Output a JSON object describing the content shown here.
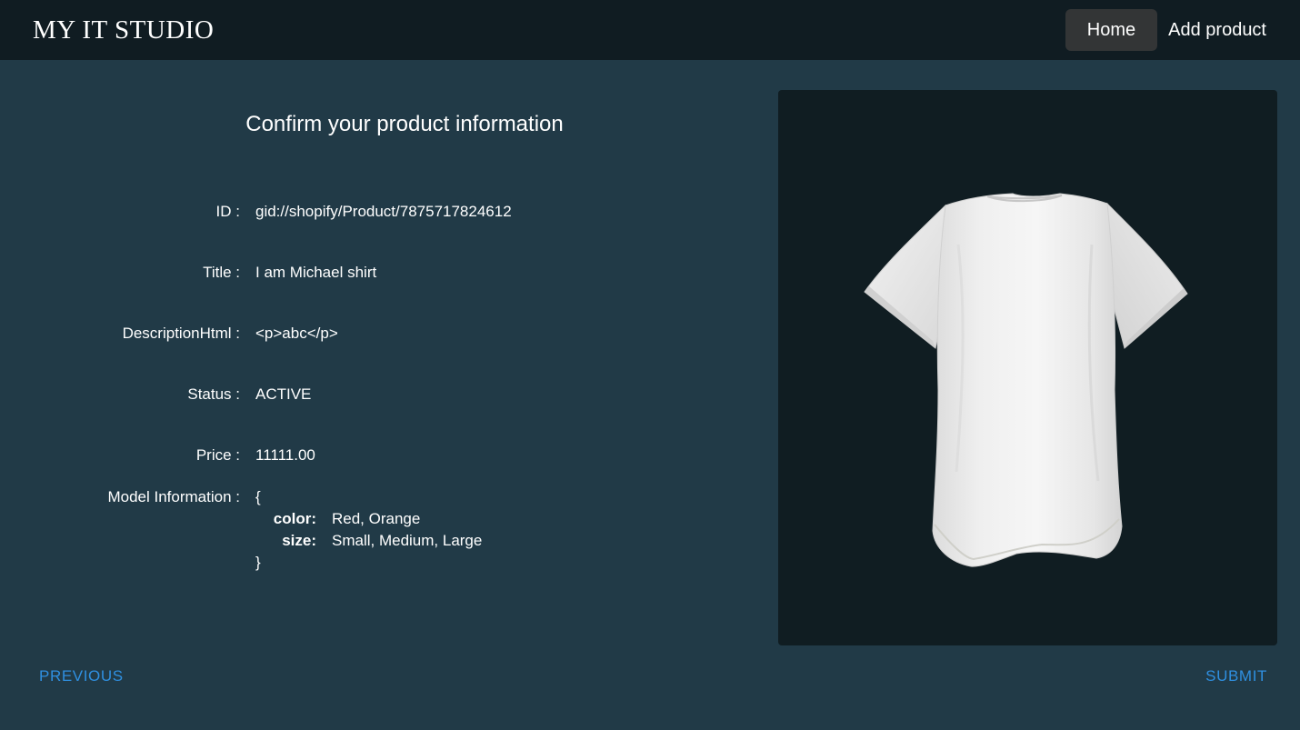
{
  "header": {
    "brand": "MY IT STUDIO",
    "nav": {
      "home_label": "Home",
      "add_product_label": "Add product"
    }
  },
  "main": {
    "title": "Confirm your product information",
    "fields": {
      "id": {
        "label": "ID :",
        "value": "gid://shopify/Product/7875717824612"
      },
      "title": {
        "label": "Title :",
        "value": "I am Michael shirt"
      },
      "description": {
        "label": "DescriptionHtml :",
        "value": "<p>abc</p>"
      },
      "status": {
        "label": "Status :",
        "value": "ACTIVE"
      },
      "price": {
        "label": "Price :",
        "value": "11111.00"
      }
    },
    "model_information": {
      "label": "Model Information :",
      "open_brace": "{",
      "close_brace": "}",
      "color_key": "color:",
      "color_value": "Red, Orange",
      "size_key": "size:",
      "size_value": "Small, Medium, Large"
    }
  },
  "preview": {
    "icon": "tshirt-3d-model",
    "background": "#101d22"
  },
  "footer": {
    "previous_label": "PREVIOUS",
    "submit_label": "SUBMIT"
  },
  "colors": {
    "page_bg": "#213a47",
    "topbar_bg": "#101c22",
    "accent": "#2f8fe0",
    "nav_active_bg": "#333536"
  }
}
